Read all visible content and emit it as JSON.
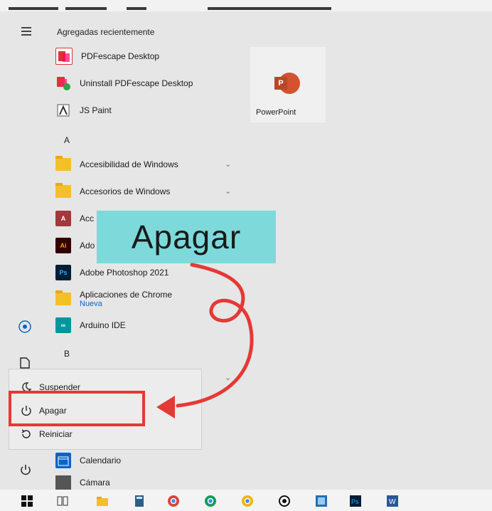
{
  "start_menu": {
    "recently_added_header": "Agregadas recientemente",
    "recent_apps": [
      {
        "label": "PDFescape Desktop",
        "icon": "pdfescape-icon"
      },
      {
        "label": "Uninstall PDFescape Desktop",
        "icon": "pdfescape-uninstall-icon"
      },
      {
        "label": "JS Paint",
        "icon": "jspaint-icon"
      }
    ],
    "letter_a": "A",
    "apps_a": [
      {
        "label": "Accesibilidad de Windows",
        "icon": "folder-icon"
      },
      {
        "label": "Accesorios de Windows",
        "icon": "folder-icon"
      },
      {
        "label": "Acc",
        "icon": "access-icon",
        "glyph": "A"
      },
      {
        "label": "Ado",
        "icon": "adobe-illustrator-icon",
        "glyph": "Ai"
      },
      {
        "label": "Adobe Photoshop 2021",
        "icon": "photoshop-icon",
        "glyph": "Ps"
      },
      {
        "label": "Aplicaciones de Chrome",
        "sublabel": "Nueva",
        "icon": "folder-icon"
      },
      {
        "label": "Arduino IDE",
        "icon": "arduino-icon",
        "glyph": "∞"
      }
    ],
    "letter_b": "B",
    "apps_c": [
      {
        "label": "Calendario",
        "icon": "calendar-icon"
      },
      {
        "label": "Cámara",
        "icon": "camera-icon"
      }
    ]
  },
  "tile": {
    "label": "PowerPoint",
    "glyph": "P"
  },
  "callout": {
    "text": "Apagar"
  },
  "power_menu": {
    "items": [
      {
        "label": "Suspender",
        "icon": "moon-icon"
      },
      {
        "label": "Apagar",
        "icon": "power-icon"
      },
      {
        "label": "Reiniciar",
        "icon": "restart-icon"
      }
    ]
  },
  "colors": {
    "highlight": "#e53935",
    "callout_bg": "#7ed9db",
    "accent": "#0b63c9"
  }
}
